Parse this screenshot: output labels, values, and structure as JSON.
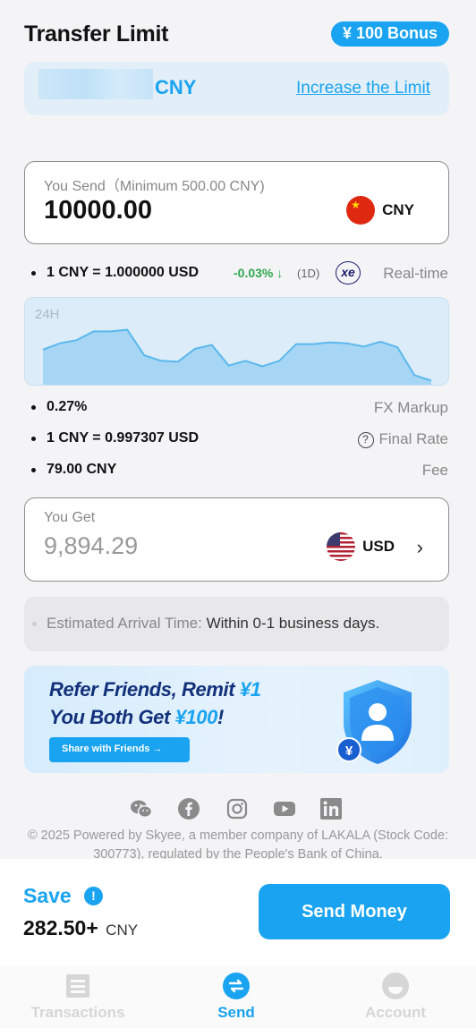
{
  "header": {
    "title": "Transfer Limit",
    "bonus_badge": "¥ 100 Bonus"
  },
  "limit": {
    "currency": "CNY",
    "link": "Increase the Limit"
  },
  "send": {
    "label": "You Send（Minimum 500.00 CNY)",
    "amount": "10000.00",
    "currency": "CNY"
  },
  "rate": {
    "text": "1 CNY = 1.000000 USD",
    "change": "-0.03% ↓",
    "period": "(1D)",
    "xe_logo": "xe",
    "realtime_label": "Real-time"
  },
  "chart_data": {
    "type": "area",
    "label": "24H",
    "values": [
      0.44,
      0.52,
      0.56,
      0.67,
      0.67,
      0.69,
      0.37,
      0.3,
      0.29,
      0.45,
      0.5,
      0.24,
      0.3,
      0.23,
      0.3,
      0.51,
      0.51,
      0.53,
      0.52,
      0.48,
      0.54,
      0.47,
      0.12,
      0.05
    ],
    "color": "#5bb8ec",
    "fill": "#a7d6f5"
  },
  "details": {
    "fx_markup": {
      "value": "0.27%",
      "label": "FX Markup"
    },
    "final_rate": {
      "value": "1 CNY = 0.997307 USD",
      "icon": "?",
      "label": "Final Rate"
    },
    "fee": {
      "value": "79.00 CNY",
      "label": "Fee"
    }
  },
  "get": {
    "label": "You Get",
    "amount": "9,894.29",
    "currency": "USD"
  },
  "arrival": {
    "label": "Estimated Arrival Time:",
    "value": "Within 0-1 business days."
  },
  "referral": {
    "line1_prefix": "Refer Friends, Remit ",
    "line1_highlight": "¥1",
    "line2_prefix": "You Both Get ",
    "line2_highlight": "¥100",
    "line2_suffix": "!",
    "button": "Share with Friends →"
  },
  "social": [
    "wechat-icon",
    "facebook-icon",
    "instagram-icon",
    "youtube-icon",
    "linkedin-icon"
  ],
  "footer": {
    "text": "© 2025 Powered by Skyee, a member company of LAKALA (Stock Code: 300773), regulated by the People's Bank of China."
  },
  "save": {
    "title": "Save",
    "info_icon": "!",
    "amount": "282.50+",
    "currency": "CNY",
    "button": "Send Money"
  },
  "tabs": [
    {
      "label": "Transactions",
      "icon": "transactions-icon",
      "active": false
    },
    {
      "label": "Send",
      "icon": "send-icon",
      "active": true
    },
    {
      "label": "Account",
      "icon": "account-icon",
      "active": false
    }
  ],
  "colors": {
    "accent": "#1aa3f0",
    "positive": "#2fa84f",
    "navy": "#13317a"
  }
}
